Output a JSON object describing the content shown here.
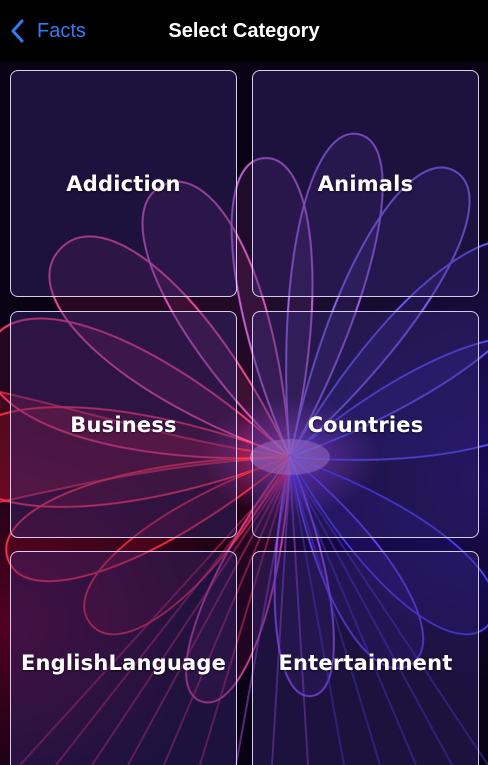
{
  "nav": {
    "back_label": "Facts",
    "title": "Select Category"
  },
  "categories": [
    {
      "label": "Addiction"
    },
    {
      "label": "Animals"
    },
    {
      "label": "Business"
    },
    {
      "label": "Countries"
    },
    {
      "label": "EnglishLanguage"
    },
    {
      "label": "Entertainment"
    }
  ],
  "colors": {
    "accent": "#2e7cf6",
    "nav_background": "#000000",
    "title_text": "#ffffff",
    "tile_border": "#ebe1ff"
  }
}
